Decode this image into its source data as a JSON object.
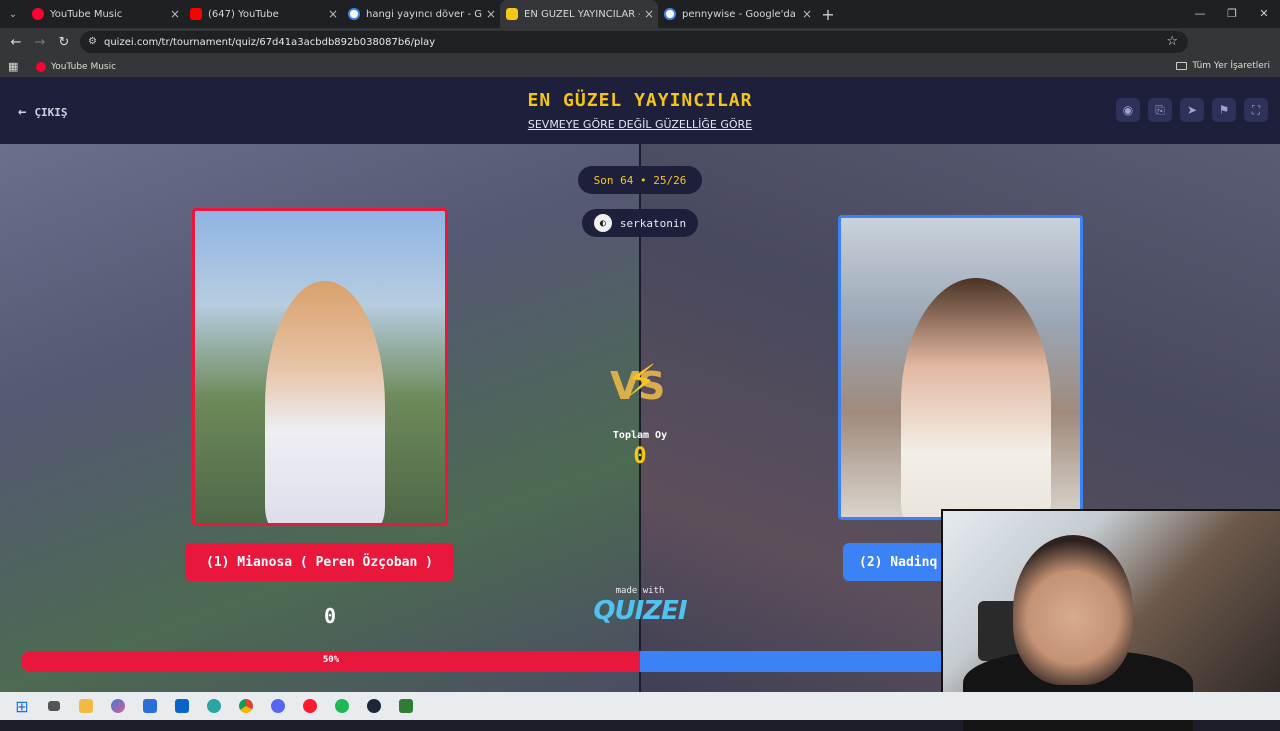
{
  "browser": {
    "tabs": [
      {
        "title": "YouTube Music",
        "favicon_color": "#ff0033",
        "active": false
      },
      {
        "title": "(647) YouTube",
        "favicon_color": "#ff0000",
        "active": false
      },
      {
        "title": "hangi yayıncı döver - Google'da",
        "favicon_color": "#4285f4",
        "active": false
      },
      {
        "title": "EN GÜZEL YAYINCILAR - Tier Li",
        "favicon_color": "#f5c518",
        "active": true
      },
      {
        "title": "pennywise - Google'da Ara",
        "favicon_color": "#4285f4",
        "active": false
      }
    ],
    "url": "quizei.com/tr/tournament/quiz/67d41a3acbdb892b038087b6/play",
    "bookmarks": [
      {
        "label": "YouTube Music"
      }
    ],
    "all_bookmarks_label": "Tüm Yer İşaretleri"
  },
  "header": {
    "back_label": "ÇIKIŞ",
    "title": "EN GÜZEL YAYINCILAR",
    "subtitle": "SEVMEYE GÖRE DEĞİL GÜZELLİĞE GÖRE",
    "icons": [
      "eye-icon",
      "share-icon",
      "send-icon",
      "flag-icon",
      "fullscreen-icon"
    ]
  },
  "round": {
    "label": "Son 64 • 25/26",
    "user": "serkatonin",
    "user_icon": "controller-icon"
  },
  "left": {
    "name": "(1) Mianosa ( Peren Özçoban )",
    "score": "0",
    "color": "#e8173b"
  },
  "right": {
    "name": "(2) Nadinq",
    "color": "#3b82f6"
  },
  "center": {
    "total_label": "Toplam Oy",
    "total_value": "0",
    "made_with": "made with",
    "logo": "QUIZEI"
  },
  "progress": {
    "label": "50%",
    "left_fraction": 0.5
  },
  "taskbar": {
    "icons": [
      "windows-icon",
      "task-view-icon",
      "file-explorer-icon",
      "copilot-icon",
      "store-icon",
      "outlook-icon",
      "edge-icon",
      "chrome-icon",
      "discord-icon",
      "opera-icon",
      "spotify-icon",
      "steam-icon",
      "terminal-icon"
    ]
  }
}
